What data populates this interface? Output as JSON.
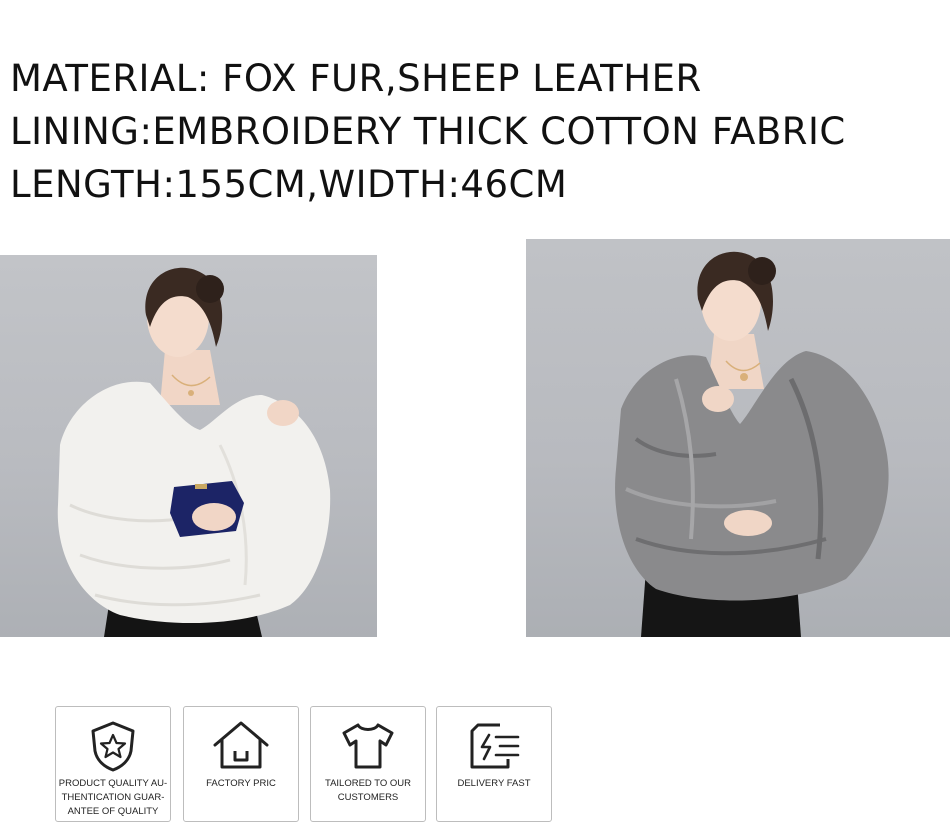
{
  "specs": {
    "material": "MATERIAL: FOX FUR,SHEEP LEATHER",
    "lining": "LINING:EMBROIDERY THICK COTTON FABRIC",
    "size": "LENGTH:155CM,WIDTH:46CM"
  },
  "photos": [
    {
      "name": "white-fox-fur-shawl-photo",
      "colors": {
        "fur": "#f2f1ee",
        "clutch": "#1c2466"
      }
    },
    {
      "name": "grey-fox-fur-shawl-photo",
      "colors": {
        "fur": "#8a8a8c"
      }
    }
  ],
  "badges": [
    {
      "icon": "shield-star-icon",
      "label": "PRODUCT QUALITY AU-THENTICATION GUAR-ANTEE OF QUALITY"
    },
    {
      "icon": "house-icon",
      "label": "FACTORY PRIC"
    },
    {
      "icon": "tshirt-icon",
      "label": "TAILORED TO OUR CUSTOMERS"
    },
    {
      "icon": "fast-delivery-icon",
      "label": "DELIVERY FAST"
    }
  ]
}
